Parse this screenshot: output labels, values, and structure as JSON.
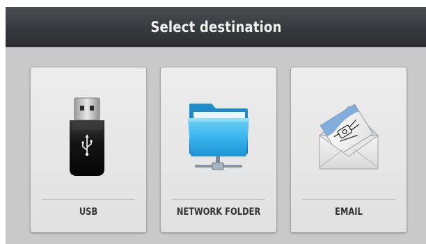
{
  "header": {
    "title": "Select destination"
  },
  "destinations": [
    {
      "label": "USB",
      "icon": "usb-drive-icon"
    },
    {
      "label": "NETWORK FOLDER",
      "icon": "network-folder-icon"
    },
    {
      "label": "EMAIL",
      "icon": "email-envelope-icon"
    }
  ],
  "colors": {
    "header_background": "#36393d",
    "screen_background": "#c9c9c9",
    "tile_background": "#e6e6e6",
    "folder_blue": "#2aa6e0"
  }
}
